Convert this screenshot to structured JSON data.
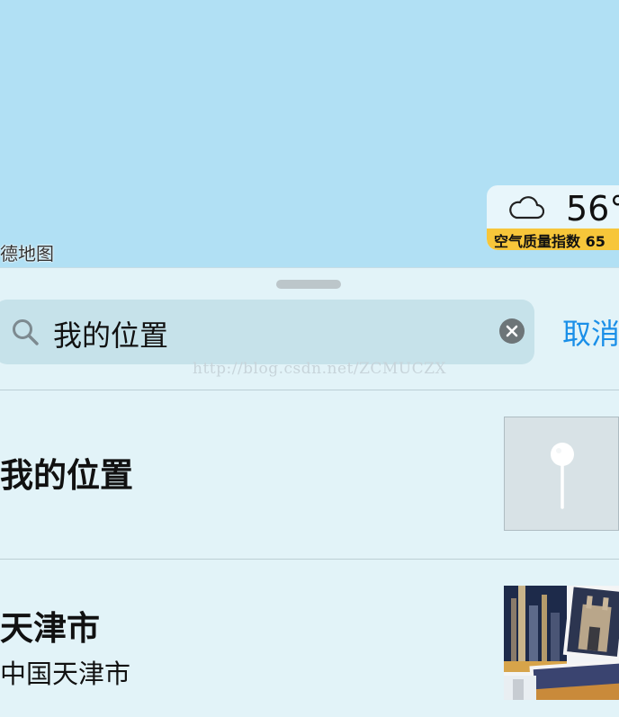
{
  "map": {
    "attribution": "德地图"
  },
  "weather": {
    "icon": "cloud-icon",
    "temperature": "56°",
    "aqi_label": "空气质量指数 65"
  },
  "search": {
    "value": "我的位置",
    "cancel_label": "取消"
  },
  "watermark": "http://blog.csdn.net/ZCMUCZX",
  "results": [
    {
      "title": "我的位置",
      "thumbnail": "pin-icon"
    },
    {
      "title": "天津市",
      "subtitle": "中国天津市",
      "thumbnail": "city-photo"
    }
  ],
  "colors": {
    "map_water": "#b1e0f4",
    "sheet_bg": "#e2f3f8",
    "accent": "#1a8fe8",
    "aqi_badge": "#f7c63a"
  }
}
